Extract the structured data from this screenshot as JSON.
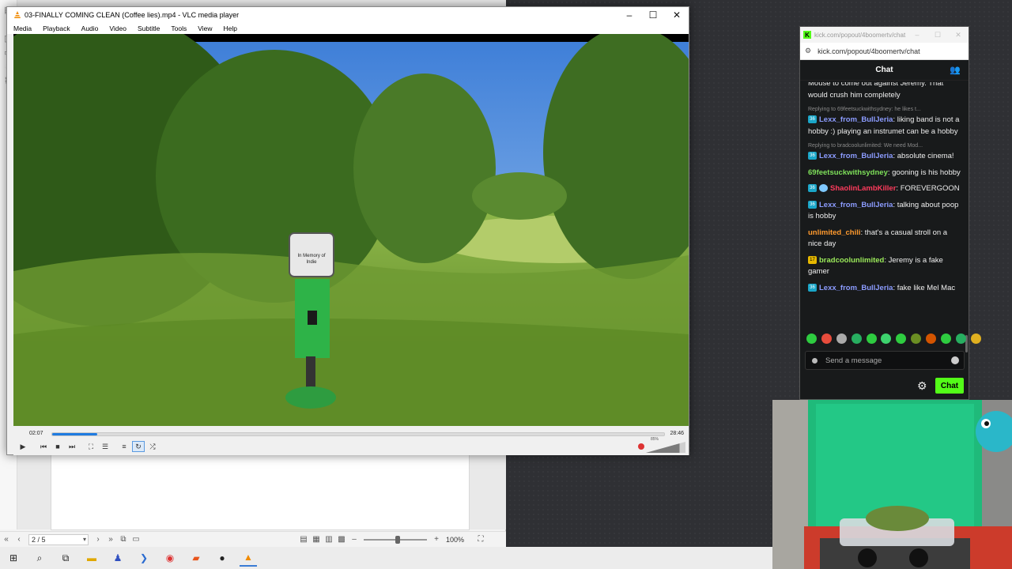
{
  "doc_window": {
    "page_count": "2 / 5",
    "zoom": "100%"
  },
  "vlc": {
    "title": "03-FINALLY COMING CLEAN (Coffee lies).mp4 - VLC media player",
    "menu": [
      "Media",
      "Playback",
      "Audio",
      "Video",
      "Subtitle",
      "Tools",
      "View",
      "Help"
    ],
    "sign_text": "In Memory of Indie",
    "time_elapsed": "02:07",
    "time_total": "28:46",
    "progress": 0.074,
    "volume_text": "85%",
    "volume": 0.85
  },
  "chat_window": {
    "title": "kick.com/popout/4boomertv/chat",
    "url": "kick.com/popout/4boomertv/chat",
    "header": "Chat",
    "input_placeholder": "Send a message",
    "send_label": "Chat",
    "colors": {
      "accent": "#53fc18",
      "background": "#181a1b"
    },
    "messages": [
      {
        "reply": "",
        "badge": "",
        "user": "",
        "user_color": "#ffffff",
        "text": "Mouse to come out against Jeremy. That would crush him completely",
        "clip_top": true
      },
      {
        "reply": "Replying to 69feetsuckwithsydney: he likes t...",
        "badge": "36",
        "user": "Lexx_from_BullJeria",
        "user_color": "#8c9cff",
        "text": "liking band is not a hobby :) playing an instrumet can be a hobby"
      },
      {
        "reply": "Replying to bradcoolunlimited: We need Mod...",
        "badge": "36",
        "user": "Lexx_from_BullJeria",
        "user_color": "#8c9cff",
        "text": "absolute cinema!"
      },
      {
        "reply": "",
        "badge": "",
        "user": "69feetsuckwithsydney",
        "user_color": "#7ee05a",
        "text": "gooning is his hobby"
      },
      {
        "reply": "",
        "badge": "36",
        "badge2": "face",
        "user": "ShaolinLambKiller",
        "user_color": "#ff3b5c",
        "text": "FOREVERGOON"
      },
      {
        "reply": "",
        "badge": "36",
        "user": "Lexx_from_BullJeria",
        "user_color": "#8c9cff",
        "text": "talking about poop is hobby"
      },
      {
        "reply": "",
        "badge": "",
        "user": "unlimited_chili",
        "user_color": "#ff9a2e",
        "text": "that's a casual stroll on a nice day"
      },
      {
        "reply": "",
        "badge": "17",
        "badge_type": "gold",
        "user": "bradcoolunlimited",
        "user_color": "#9bea5a",
        "text": "Jeremy is a fake gamer"
      },
      {
        "reply": "",
        "badge": "36",
        "user": "Lexx_from_BullJeria",
        "user_color": "#8c9cff",
        "text": "fake like Mel Mac"
      }
    ],
    "emotes": [
      "#2ecc40",
      "#e74c3c",
      "#aaaaaa",
      "#27ae60",
      "#2ecc40",
      "#3dd36e",
      "#2ecc40",
      "#6b8e23",
      "#d35400",
      "#2ecc40",
      "#27ae60",
      "#e0b020"
    ]
  },
  "taskbar": {
    "items": [
      "start-icon",
      "search-icon",
      "task-view-icon",
      "file-explorer-icon",
      "app-icon",
      "powershell-icon",
      "chrome-icon",
      "pdf-icon",
      "obs-icon",
      "vlc-icon"
    ]
  }
}
